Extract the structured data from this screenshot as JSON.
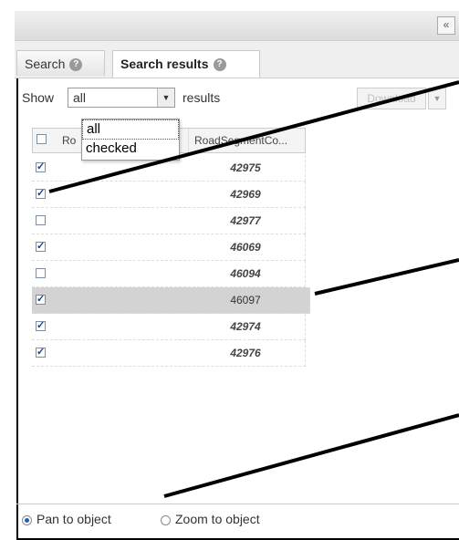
{
  "tabs": [
    {
      "label": "Search"
    },
    {
      "label": "Search results"
    }
  ],
  "show": {
    "label": "Show",
    "value": "all",
    "suffix": "results",
    "options": [
      "all",
      "checked"
    ]
  },
  "download_label": "Download",
  "columns": [
    "Ro",
    "RoadSegmentCo..."
  ],
  "rows": [
    {
      "value": "42975",
      "checked": true
    },
    {
      "value": "42969",
      "checked": true
    },
    {
      "value": "42977",
      "checked": false
    },
    {
      "value": "46069",
      "checked": true
    },
    {
      "value": "46094",
      "checked": false
    },
    {
      "value": "46097",
      "checked": true
    },
    {
      "value": "42974",
      "checked": true
    },
    {
      "value": "42976",
      "checked": true
    }
  ],
  "footer": {
    "pan_label": "Pan to object",
    "zoom_label": "Zoom to object",
    "selected": "pan"
  },
  "collapse_icon": "double-chevron-left-icon",
  "help_icon": "help-icon",
  "colors": {
    "highlight_row": "#d3d3d3",
    "checkbox_mark": "#1e3f8a"
  }
}
